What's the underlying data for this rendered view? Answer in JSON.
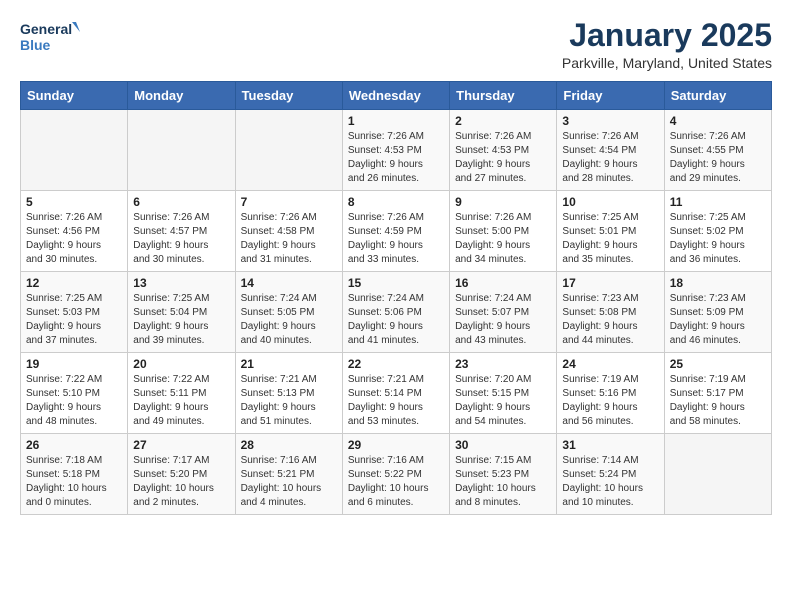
{
  "logo": {
    "line1": "General",
    "line2": "Blue"
  },
  "header": {
    "month": "January 2025",
    "location": "Parkville, Maryland, United States"
  },
  "weekdays": [
    "Sunday",
    "Monday",
    "Tuesday",
    "Wednesday",
    "Thursday",
    "Friday",
    "Saturday"
  ],
  "weeks": [
    [
      {
        "day": "",
        "info": ""
      },
      {
        "day": "",
        "info": ""
      },
      {
        "day": "",
        "info": ""
      },
      {
        "day": "1",
        "info": "Sunrise: 7:26 AM\nSunset: 4:53 PM\nDaylight: 9 hours\nand 26 minutes."
      },
      {
        "day": "2",
        "info": "Sunrise: 7:26 AM\nSunset: 4:53 PM\nDaylight: 9 hours\nand 27 minutes."
      },
      {
        "day": "3",
        "info": "Sunrise: 7:26 AM\nSunset: 4:54 PM\nDaylight: 9 hours\nand 28 minutes."
      },
      {
        "day": "4",
        "info": "Sunrise: 7:26 AM\nSunset: 4:55 PM\nDaylight: 9 hours\nand 29 minutes."
      }
    ],
    [
      {
        "day": "5",
        "info": "Sunrise: 7:26 AM\nSunset: 4:56 PM\nDaylight: 9 hours\nand 30 minutes."
      },
      {
        "day": "6",
        "info": "Sunrise: 7:26 AM\nSunset: 4:57 PM\nDaylight: 9 hours\nand 30 minutes."
      },
      {
        "day": "7",
        "info": "Sunrise: 7:26 AM\nSunset: 4:58 PM\nDaylight: 9 hours\nand 31 minutes."
      },
      {
        "day": "8",
        "info": "Sunrise: 7:26 AM\nSunset: 4:59 PM\nDaylight: 9 hours\nand 33 minutes."
      },
      {
        "day": "9",
        "info": "Sunrise: 7:26 AM\nSunset: 5:00 PM\nDaylight: 9 hours\nand 34 minutes."
      },
      {
        "day": "10",
        "info": "Sunrise: 7:25 AM\nSunset: 5:01 PM\nDaylight: 9 hours\nand 35 minutes."
      },
      {
        "day": "11",
        "info": "Sunrise: 7:25 AM\nSunset: 5:02 PM\nDaylight: 9 hours\nand 36 minutes."
      }
    ],
    [
      {
        "day": "12",
        "info": "Sunrise: 7:25 AM\nSunset: 5:03 PM\nDaylight: 9 hours\nand 37 minutes."
      },
      {
        "day": "13",
        "info": "Sunrise: 7:25 AM\nSunset: 5:04 PM\nDaylight: 9 hours\nand 39 minutes."
      },
      {
        "day": "14",
        "info": "Sunrise: 7:24 AM\nSunset: 5:05 PM\nDaylight: 9 hours\nand 40 minutes."
      },
      {
        "day": "15",
        "info": "Sunrise: 7:24 AM\nSunset: 5:06 PM\nDaylight: 9 hours\nand 41 minutes."
      },
      {
        "day": "16",
        "info": "Sunrise: 7:24 AM\nSunset: 5:07 PM\nDaylight: 9 hours\nand 43 minutes."
      },
      {
        "day": "17",
        "info": "Sunrise: 7:23 AM\nSunset: 5:08 PM\nDaylight: 9 hours\nand 44 minutes."
      },
      {
        "day": "18",
        "info": "Sunrise: 7:23 AM\nSunset: 5:09 PM\nDaylight: 9 hours\nand 46 minutes."
      }
    ],
    [
      {
        "day": "19",
        "info": "Sunrise: 7:22 AM\nSunset: 5:10 PM\nDaylight: 9 hours\nand 48 minutes."
      },
      {
        "day": "20",
        "info": "Sunrise: 7:22 AM\nSunset: 5:11 PM\nDaylight: 9 hours\nand 49 minutes."
      },
      {
        "day": "21",
        "info": "Sunrise: 7:21 AM\nSunset: 5:13 PM\nDaylight: 9 hours\nand 51 minutes."
      },
      {
        "day": "22",
        "info": "Sunrise: 7:21 AM\nSunset: 5:14 PM\nDaylight: 9 hours\nand 53 minutes."
      },
      {
        "day": "23",
        "info": "Sunrise: 7:20 AM\nSunset: 5:15 PM\nDaylight: 9 hours\nand 54 minutes."
      },
      {
        "day": "24",
        "info": "Sunrise: 7:19 AM\nSunset: 5:16 PM\nDaylight: 9 hours\nand 56 minutes."
      },
      {
        "day": "25",
        "info": "Sunrise: 7:19 AM\nSunset: 5:17 PM\nDaylight: 9 hours\nand 58 minutes."
      }
    ],
    [
      {
        "day": "26",
        "info": "Sunrise: 7:18 AM\nSunset: 5:18 PM\nDaylight: 10 hours\nand 0 minutes."
      },
      {
        "day": "27",
        "info": "Sunrise: 7:17 AM\nSunset: 5:20 PM\nDaylight: 10 hours\nand 2 minutes."
      },
      {
        "day": "28",
        "info": "Sunrise: 7:16 AM\nSunset: 5:21 PM\nDaylight: 10 hours\nand 4 minutes."
      },
      {
        "day": "29",
        "info": "Sunrise: 7:16 AM\nSunset: 5:22 PM\nDaylight: 10 hours\nand 6 minutes."
      },
      {
        "day": "30",
        "info": "Sunrise: 7:15 AM\nSunset: 5:23 PM\nDaylight: 10 hours\nand 8 minutes."
      },
      {
        "day": "31",
        "info": "Sunrise: 7:14 AM\nSunset: 5:24 PM\nDaylight: 10 hours\nand 10 minutes."
      },
      {
        "day": "",
        "info": ""
      }
    ]
  ]
}
